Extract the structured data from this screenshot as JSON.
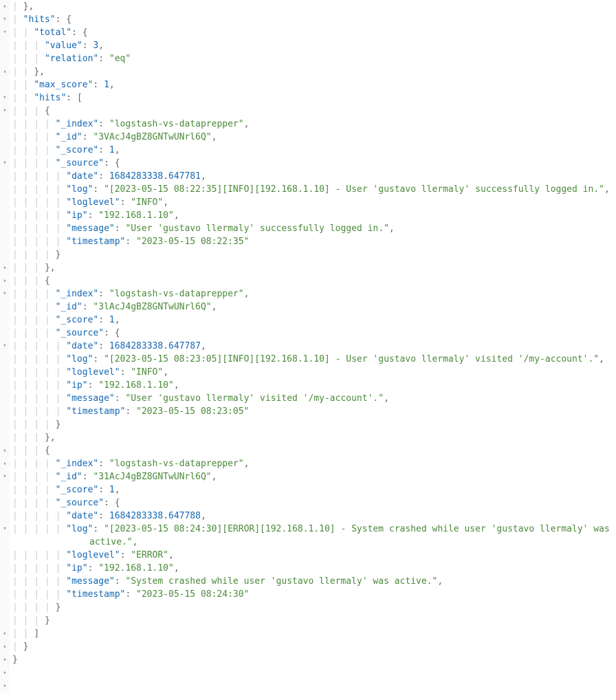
{
  "gutter_collapse": "▸",
  "gutter_expand": "▾",
  "gutter_up": "▴",
  "lines": [
    {
      "g": "▴",
      "indent": 1,
      "text_parts": [
        {
          "t": "}",
          "c": "brace"
        },
        {
          "t": ",",
          "c": "punct"
        }
      ]
    },
    {
      "g": "▾",
      "indent": 1,
      "text_parts": [
        {
          "t": "\"hits\"",
          "c": "key"
        },
        {
          "t": ": ",
          "c": "punct"
        },
        {
          "t": "{",
          "c": "brace"
        }
      ]
    },
    {
      "g": "▾",
      "indent": 2,
      "text_parts": [
        {
          "t": "\"total\"",
          "c": "key"
        },
        {
          "t": ": ",
          "c": "punct"
        },
        {
          "t": "{",
          "c": "brace"
        }
      ]
    },
    {
      "g": "",
      "indent": 3,
      "text_parts": [
        {
          "t": "\"value\"",
          "c": "key"
        },
        {
          "t": ": ",
          "c": "punct"
        },
        {
          "t": "3",
          "c": "number"
        },
        {
          "t": ",",
          "c": "punct"
        }
      ]
    },
    {
      "g": "",
      "indent": 3,
      "text_parts": [
        {
          "t": "\"relation\"",
          "c": "key"
        },
        {
          "t": ": ",
          "c": "punct"
        },
        {
          "t": "\"eq\"",
          "c": "string"
        }
      ]
    },
    {
      "g": "▴",
      "indent": 2,
      "text_parts": [
        {
          "t": "}",
          "c": "brace"
        },
        {
          "t": ",",
          "c": "punct"
        }
      ]
    },
    {
      "g": "",
      "indent": 2,
      "text_parts": [
        {
          "t": "\"max_score\"",
          "c": "key"
        },
        {
          "t": ": ",
          "c": "punct"
        },
        {
          "t": "1",
          "c": "number"
        },
        {
          "t": ",",
          "c": "punct"
        }
      ]
    },
    {
      "g": "▾",
      "indent": 2,
      "text_parts": [
        {
          "t": "\"hits\"",
          "c": "key"
        },
        {
          "t": ": ",
          "c": "punct"
        },
        {
          "t": "[",
          "c": "brace"
        }
      ]
    },
    {
      "g": "▾",
      "indent": 3,
      "text_parts": [
        {
          "t": "{",
          "c": "brace"
        }
      ]
    },
    {
      "g": "",
      "indent": 4,
      "text_parts": [
        {
          "t": "\"_index\"",
          "c": "key"
        },
        {
          "t": ": ",
          "c": "punct"
        },
        {
          "t": "\"logstash-vs-dataprepper\"",
          "c": "string"
        },
        {
          "t": ",",
          "c": "punct"
        }
      ]
    },
    {
      "g": "",
      "indent": 4,
      "text_parts": [
        {
          "t": "\"_id\"",
          "c": "key"
        },
        {
          "t": ": ",
          "c": "punct"
        },
        {
          "t": "\"3VAcJ4gBZ8GNTwUNrl6Q\"",
          "c": "string"
        },
        {
          "t": ",",
          "c": "punct"
        }
      ]
    },
    {
      "g": "",
      "indent": 4,
      "text_parts": [
        {
          "t": "\"_score\"",
          "c": "key"
        },
        {
          "t": ": ",
          "c": "punct"
        },
        {
          "t": "1",
          "c": "number"
        },
        {
          "t": ",",
          "c": "punct"
        }
      ]
    },
    {
      "g": "▾",
      "indent": 4,
      "text_parts": [
        {
          "t": "\"_source\"",
          "c": "key"
        },
        {
          "t": ": ",
          "c": "punct"
        },
        {
          "t": "{",
          "c": "brace"
        }
      ]
    },
    {
      "g": "",
      "indent": 5,
      "text_parts": [
        {
          "t": "\"date\"",
          "c": "key"
        },
        {
          "t": ": ",
          "c": "punct"
        },
        {
          "t": "1684283338.647781",
          "c": "number"
        },
        {
          "t": ",",
          "c": "punct"
        }
      ]
    },
    {
      "g": "",
      "indent": 5,
      "wrap": true,
      "text_parts": [
        {
          "t": "\"log\"",
          "c": "key"
        },
        {
          "t": ": ",
          "c": "punct"
        },
        {
          "t": "\"[2023-05-15 08:22:35][INFO][192.168.1.10] - User 'gustavo llermaly' successfully logged in.\"",
          "c": "string"
        },
        {
          "t": ",",
          "c": "punct"
        }
      ]
    },
    {
      "g": "",
      "indent": 5,
      "text_parts": [
        {
          "t": "\"loglevel\"",
          "c": "key"
        },
        {
          "t": ": ",
          "c": "punct"
        },
        {
          "t": "\"INFO\"",
          "c": "string"
        },
        {
          "t": ",",
          "c": "punct"
        }
      ]
    },
    {
      "g": "",
      "indent": 5,
      "text_parts": [
        {
          "t": "\"ip\"",
          "c": "key"
        },
        {
          "t": ": ",
          "c": "punct"
        },
        {
          "t": "\"192.168.1.10\"",
          "c": "string"
        },
        {
          "t": ",",
          "c": "punct"
        }
      ]
    },
    {
      "g": "",
      "indent": 5,
      "text_parts": [
        {
          "t": "\"message\"",
          "c": "key"
        },
        {
          "t": ": ",
          "c": "punct"
        },
        {
          "t": "\"User 'gustavo llermaly' successfully logged in.\"",
          "c": "string"
        },
        {
          "t": ",",
          "c": "punct"
        }
      ]
    },
    {
      "g": "",
      "indent": 5,
      "text_parts": [
        {
          "t": "\"timestamp\"",
          "c": "key"
        },
        {
          "t": ": ",
          "c": "punct"
        },
        {
          "t": "\"2023-05-15 08:22:35\"",
          "c": "string"
        }
      ]
    },
    {
      "g": "▴",
      "indent": 4,
      "text_parts": [
        {
          "t": "}",
          "c": "brace"
        }
      ]
    },
    {
      "g": "▴",
      "indent": 3,
      "text_parts": [
        {
          "t": "}",
          "c": "brace"
        },
        {
          "t": ",",
          "c": "punct"
        }
      ]
    },
    {
      "g": "▾",
      "indent": 3,
      "text_parts": [
        {
          "t": "{",
          "c": "brace"
        }
      ]
    },
    {
      "g": "",
      "indent": 4,
      "text_parts": [
        {
          "t": "\"_index\"",
          "c": "key"
        },
        {
          "t": ": ",
          "c": "punct"
        },
        {
          "t": "\"logstash-vs-dataprepper\"",
          "c": "string"
        },
        {
          "t": ",",
          "c": "punct"
        }
      ]
    },
    {
      "g": "",
      "indent": 4,
      "text_parts": [
        {
          "t": "\"_id\"",
          "c": "key"
        },
        {
          "t": ": ",
          "c": "punct"
        },
        {
          "t": "\"3lAcJ4gBZ8GNTwUNrl6Q\"",
          "c": "string"
        },
        {
          "t": ",",
          "c": "punct"
        }
      ]
    },
    {
      "g": "",
      "indent": 4,
      "text_parts": [
        {
          "t": "\"_score\"",
          "c": "key"
        },
        {
          "t": ": ",
          "c": "punct"
        },
        {
          "t": "1",
          "c": "number"
        },
        {
          "t": ",",
          "c": "punct"
        }
      ]
    },
    {
      "g": "▾",
      "indent": 4,
      "text_parts": [
        {
          "t": "\"_source\"",
          "c": "key"
        },
        {
          "t": ": ",
          "c": "punct"
        },
        {
          "t": "{",
          "c": "brace"
        }
      ]
    },
    {
      "g": "",
      "indent": 5,
      "text_parts": [
        {
          "t": "\"date\"",
          "c": "key"
        },
        {
          "t": ": ",
          "c": "punct"
        },
        {
          "t": "1684283338.647787",
          "c": "number"
        },
        {
          "t": ",",
          "c": "punct"
        }
      ]
    },
    {
      "g": "",
      "indent": 5,
      "wrap": true,
      "text_parts": [
        {
          "t": "\"log\"",
          "c": "key"
        },
        {
          "t": ": ",
          "c": "punct"
        },
        {
          "t": "\"[2023-05-15 08:23:05][INFO][192.168.1.10] - User 'gustavo llermaly' visited '/my-account'.\"",
          "c": "string"
        },
        {
          "t": ",",
          "c": "punct"
        }
      ]
    },
    {
      "g": "",
      "indent": 5,
      "text_parts": [
        {
          "t": "\"loglevel\"",
          "c": "key"
        },
        {
          "t": ": ",
          "c": "punct"
        },
        {
          "t": "\"INFO\"",
          "c": "string"
        },
        {
          "t": ",",
          "c": "punct"
        }
      ]
    },
    {
      "g": "",
      "indent": 5,
      "text_parts": [
        {
          "t": "\"ip\"",
          "c": "key"
        },
        {
          "t": ": ",
          "c": "punct"
        },
        {
          "t": "\"192.168.1.10\"",
          "c": "string"
        },
        {
          "t": ",",
          "c": "punct"
        }
      ]
    },
    {
      "g": "",
      "indent": 5,
      "text_parts": [
        {
          "t": "\"message\"",
          "c": "key"
        },
        {
          "t": ": ",
          "c": "punct"
        },
        {
          "t": "\"User 'gustavo llermaly' visited '/my-account'.\"",
          "c": "string"
        },
        {
          "t": ",",
          "c": "punct"
        }
      ]
    },
    {
      "g": "",
      "indent": 5,
      "text_parts": [
        {
          "t": "\"timestamp\"",
          "c": "key"
        },
        {
          "t": ": ",
          "c": "punct"
        },
        {
          "t": "\"2023-05-15 08:23:05\"",
          "c": "string"
        }
      ]
    },
    {
      "g": "▴",
      "indent": 4,
      "text_parts": [
        {
          "t": "}",
          "c": "brace"
        }
      ]
    },
    {
      "g": "▴",
      "indent": 3,
      "text_parts": [
        {
          "t": "}",
          "c": "brace"
        },
        {
          "t": ",",
          "c": "punct"
        }
      ]
    },
    {
      "g": "▾",
      "indent": 3,
      "text_parts": [
        {
          "t": "{",
          "c": "brace"
        }
      ]
    },
    {
      "g": "",
      "indent": 4,
      "text_parts": [
        {
          "t": "\"_index\"",
          "c": "key"
        },
        {
          "t": ": ",
          "c": "punct"
        },
        {
          "t": "\"logstash-vs-dataprepper\"",
          "c": "string"
        },
        {
          "t": ",",
          "c": "punct"
        }
      ]
    },
    {
      "g": "",
      "indent": 4,
      "text_parts": [
        {
          "t": "\"_id\"",
          "c": "key"
        },
        {
          "t": ": ",
          "c": "punct"
        },
        {
          "t": "\"31AcJ4gBZ8GNTwUNrl6Q\"",
          "c": "string"
        },
        {
          "t": ",",
          "c": "punct"
        }
      ]
    },
    {
      "g": "",
      "indent": 4,
      "text_parts": [
        {
          "t": "\"_score\"",
          "c": "key"
        },
        {
          "t": ": ",
          "c": "punct"
        },
        {
          "t": "1",
          "c": "number"
        },
        {
          "t": ",",
          "c": "punct"
        }
      ]
    },
    {
      "g": "▾",
      "indent": 4,
      "text_parts": [
        {
          "t": "\"_source\"",
          "c": "key"
        },
        {
          "t": ": ",
          "c": "punct"
        },
        {
          "t": "{",
          "c": "brace"
        }
      ]
    },
    {
      "g": "",
      "indent": 5,
      "text_parts": [
        {
          "t": "\"date\"",
          "c": "key"
        },
        {
          "t": ": ",
          "c": "punct"
        },
        {
          "t": "1684283338.647788",
          "c": "number"
        },
        {
          "t": ",",
          "c": "punct"
        }
      ]
    },
    {
      "g": "",
      "indent": 5,
      "wrap": true,
      "text_parts": [
        {
          "t": "\"log\"",
          "c": "key"
        },
        {
          "t": ": ",
          "c": "punct"
        },
        {
          "t": "\"[2023-05-15 08:24:30][ERROR][192.168.1.10] - System crashed while user 'gustavo llermaly' was active.\"",
          "c": "string"
        },
        {
          "t": ",",
          "c": "punct"
        }
      ]
    },
    {
      "g": "",
      "indent": 5,
      "text_parts": [
        {
          "t": "\"loglevel\"",
          "c": "key"
        },
        {
          "t": ": ",
          "c": "punct"
        },
        {
          "t": "\"ERROR\"",
          "c": "string"
        },
        {
          "t": ",",
          "c": "punct"
        }
      ]
    },
    {
      "g": "",
      "indent": 5,
      "text_parts": [
        {
          "t": "\"ip\"",
          "c": "key"
        },
        {
          "t": ": ",
          "c": "punct"
        },
        {
          "t": "\"192.168.1.10\"",
          "c": "string"
        },
        {
          "t": ",",
          "c": "punct"
        }
      ]
    },
    {
      "g": "",
      "indent": 5,
      "text_parts": [
        {
          "t": "\"message\"",
          "c": "key"
        },
        {
          "t": ": ",
          "c": "punct"
        },
        {
          "t": "\"System crashed while user 'gustavo llermaly' was active.\"",
          "c": "string"
        },
        {
          "t": ",",
          "c": "punct"
        }
      ]
    },
    {
      "g": "",
      "indent": 5,
      "text_parts": [
        {
          "t": "\"timestamp\"",
          "c": "key"
        },
        {
          "t": ": ",
          "c": "punct"
        },
        {
          "t": "\"2023-05-15 08:24:30\"",
          "c": "string"
        }
      ]
    },
    {
      "g": "▴",
      "indent": 4,
      "text_parts": [
        {
          "t": "}",
          "c": "brace"
        }
      ]
    },
    {
      "g": "▴",
      "indent": 3,
      "text_parts": [
        {
          "t": "}",
          "c": "brace"
        }
      ]
    },
    {
      "g": "▴",
      "indent": 2,
      "text_parts": [
        {
          "t": "]",
          "c": "brace"
        }
      ]
    },
    {
      "g": "▴",
      "indent": 1,
      "text_parts": [
        {
          "t": "}",
          "c": "brace"
        }
      ]
    },
    {
      "g": "▴",
      "indent": 0,
      "text_parts": [
        {
          "t": "}",
          "c": "brace"
        }
      ]
    }
  ]
}
